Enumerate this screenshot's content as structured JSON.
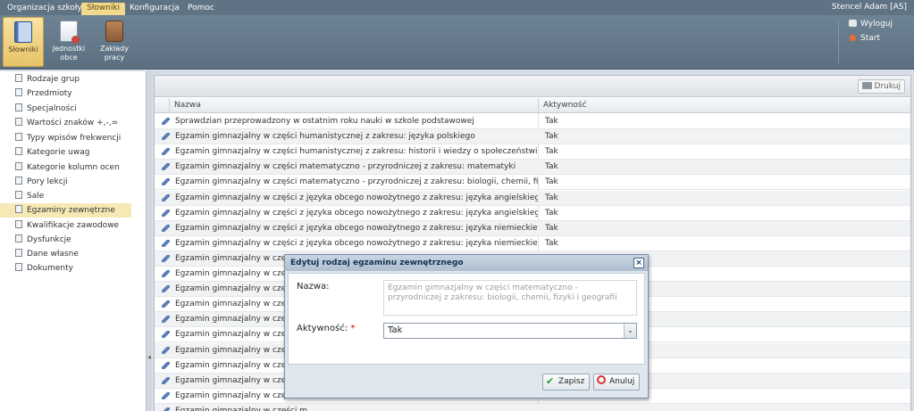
{
  "menubar": {
    "items": [
      "Organizacja szkoły",
      "Słowniki",
      "Konfiguracja",
      "Pomoc"
    ],
    "user": "Stencel Adam [AS]"
  },
  "ribbon": {
    "buttons": [
      {
        "label": "Słowniki",
        "icon": "book-icon"
      },
      {
        "label": "Jednostki obce",
        "icon": "document-icon"
      },
      {
        "label": "Zakłady pracy",
        "icon": "briefcase-icon"
      }
    ],
    "logout": "Wyloguj",
    "start": "Start"
  },
  "sidebar": {
    "items": [
      "Rodzaje grup",
      "Przedmioty",
      "Specjalności",
      "Wartości znaków +,-,=",
      "Typy wpisów frekwencji",
      "Kategorie uwag",
      "Kategorie kolumn ocen",
      "Pory lekcji",
      "Sale",
      "Egzaminy zewnętrzne",
      "Kwalifikacje zawodowe",
      "Dysfunkcje",
      "Dane własne",
      "Dokumenty"
    ],
    "active_index": 9
  },
  "grid": {
    "print_label": "Drukuj",
    "columns": [
      "Nazwa",
      "Aktywność"
    ],
    "rows": [
      {
        "name": "Sprawdzian przeprowadzony w ostatnim roku nauki w szkole podstawowej",
        "active": "Tak"
      },
      {
        "name": "Egzamin gimnazjalny w części humanistycznej z zakresu: języka polskiego",
        "active": "Tak"
      },
      {
        "name": "Egzamin gimnazjalny w części humanistycznej z zakresu: historii i wiedzy o społeczeństwie",
        "active": "Tak"
      },
      {
        "name": "Egzamin gimnazjalny w części matematyczno - przyrodniczej z zakresu: matematyki",
        "active": "Tak"
      },
      {
        "name": "Egzamin gimnazjalny w części matematyczno - przyrodniczej z zakresu: biologii, chemii, fizyki i geografii",
        "active": "Tak"
      },
      {
        "name": "Egzamin gimnazjalny w części z języka obcego nowożytnego z zakresu: języka angielskiego na pozio...",
        "active": "Tak"
      },
      {
        "name": "Egzamin gimnazjalny w części z języka obcego nowożytnego z zakresu: języka angielskiego na pozio...",
        "active": "Tak"
      },
      {
        "name": "Egzamin gimnazjalny w części z języka obcego nowożytnego z zakresu: języka niemieckiego na pozio...",
        "active": "Tak"
      },
      {
        "name": "Egzamin gimnazjalny w części z języka obcego nowożytnego z zakresu: języka niemieckiego na pozio...",
        "active": "Tak"
      },
      {
        "name": "Egzamin gimnazjalny w części z",
        "active": ""
      },
      {
        "name": "Egzamin gimnazjalny w części z",
        "active": ""
      },
      {
        "name": "Egzamin gimnazjalny w części z",
        "active": ""
      },
      {
        "name": "Egzamin gimnazjalny w części z",
        "active": ""
      },
      {
        "name": "Egzamin gimnazjalny w części z",
        "active": ""
      },
      {
        "name": "Egzamin gimnazjalny w części z",
        "active": ""
      },
      {
        "name": "Egzamin gimnazjalny w części z",
        "active": ""
      },
      {
        "name": "Egzamin gimnazjalny w części z",
        "active": ""
      },
      {
        "name": "Egzamin gimnazjalny w części z",
        "active": ""
      },
      {
        "name": "Egzamin gimnazjalny w części h",
        "active": ""
      },
      {
        "name": "Egzamin gimnazjalny w części m",
        "active": ""
      }
    ]
  },
  "dialog": {
    "title": "Edytuj rodzaj egzaminu zewnętrznego",
    "close": "×",
    "name_label": "Nazwa:",
    "name_value": "Egzamin gimnazjalny w części matematyczno - przyrodniczej z zakresu: biologii, chemii, fizyki i geografii",
    "active_label": "Aktywność:",
    "required_mark": "*",
    "active_value": "Tak",
    "select_arrow": "⌄",
    "save_label": "Zapisz",
    "cancel_label": "Anuluj"
  }
}
